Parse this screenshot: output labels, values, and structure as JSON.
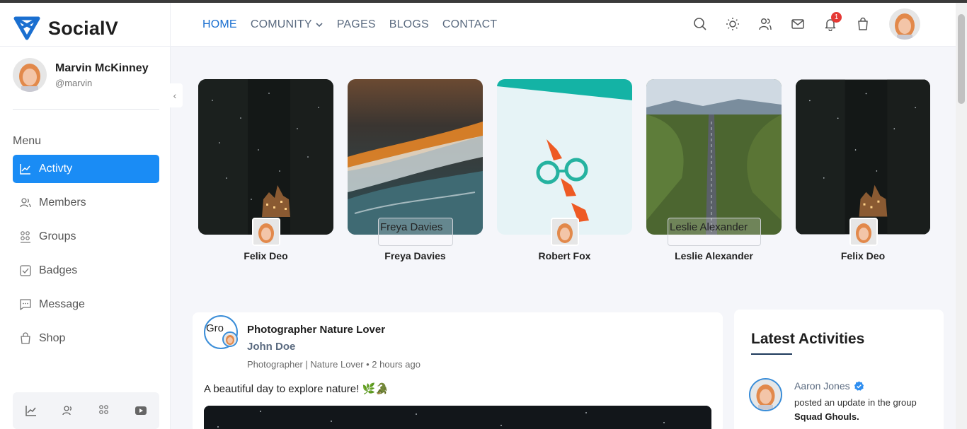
{
  "brand": {
    "name": "SocialV"
  },
  "profile": {
    "name": "Marvin McKinney",
    "handle": "@marvin"
  },
  "menu": {
    "title": "Menu",
    "items": [
      {
        "label": "Activty",
        "icon": "activity-chart-icon",
        "active": true
      },
      {
        "label": "Members",
        "icon": "members-icon"
      },
      {
        "label": "Groups",
        "icon": "groups-icon"
      },
      {
        "label": "Badges",
        "icon": "badge-icon"
      },
      {
        "label": "Message",
        "icon": "message-icon"
      },
      {
        "label": "Shop",
        "icon": "shop-bag-icon"
      }
    ]
  },
  "nav": {
    "items": [
      {
        "label": "HOME",
        "active": true
      },
      {
        "label": "COMUNITY",
        "dropdown": true
      },
      {
        "label": "PAGES"
      },
      {
        "label": "BLOGS"
      },
      {
        "label": "CONTACT"
      }
    ]
  },
  "header_icons": {
    "names": [
      "search-icon",
      "theme-toggle-sun-icon",
      "friends-icon",
      "mail-icon",
      "notification-bell-icon",
      "cart-bag-icon"
    ],
    "notification_count": "1"
  },
  "stories": [
    {
      "name": "Felix Deo",
      "scene": "night-castle",
      "image_alt": ""
    },
    {
      "name": "Freya Davies",
      "scene": "ocean-wave",
      "image_alt": "Freya Davies"
    },
    {
      "name": "Robert Fox",
      "scene": "glasses-hands",
      "image_alt": ""
    },
    {
      "name": "Leslie Alexander",
      "scene": "forest-road",
      "image_alt": "Leslie Alexander"
    },
    {
      "name": "Felix Deo",
      "scene": "night-castle",
      "image_alt": ""
    }
  ],
  "post": {
    "avatar_alt": "Gro",
    "title": "Photographer Nature Lover",
    "author": "John Doe",
    "meta": "Photographer | Nature Lover • 2 hours ago",
    "text": "A beautiful day to explore nature! 🌿🐊"
  },
  "activities": {
    "title": "Latest Activities",
    "items": [
      {
        "name": "Aaron Jones",
        "verified": true,
        "action": "posted an update in the group",
        "target": "Squad Ghouls."
      }
    ]
  },
  "colors": {
    "accent": "#1a8cf5",
    "nav_active": "#1a6fd0",
    "badge": "#e53935"
  }
}
